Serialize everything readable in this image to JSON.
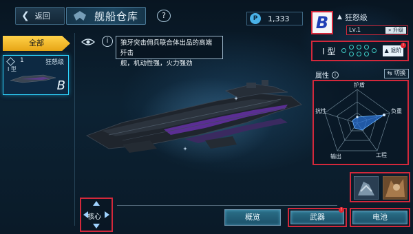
{
  "header": {
    "back_label": "返回",
    "title": "舰船仓库",
    "help_label": "?"
  },
  "sidebar": {
    "filter_label": "全部",
    "ship_card": {
      "number": "1",
      "name": "狂怒级",
      "type": "I 型",
      "grade": "B"
    }
  },
  "info": {
    "description_line1": "狼牙突击佣兵联合体出品的高端歼击",
    "description_line2": "舰，机动性强，火力强劲"
  },
  "resource": {
    "icon": "P",
    "value": "1,333"
  },
  "ship": {
    "grade": "B",
    "name": "狂怒级",
    "level": "Lv.1",
    "upgrade_label": "升级"
  },
  "refit": {
    "type_label": "I 型",
    "refit_label": "退阶"
  },
  "attributes": {
    "title": "属性",
    "switch_label": "切换",
    "axes": [
      "护盾",
      "负重",
      "工程",
      "输出",
      "抗性"
    ]
  },
  "bottom": {
    "core_label": "核心",
    "tabs": [
      "概览",
      "武器",
      "电池"
    ]
  },
  "colors": {
    "highlight_border": "#d3283b",
    "accent_cyan": "#2ed5ff",
    "filter_yellow": "#f2b825",
    "radar_fill": "#2a6fd0"
  },
  "icons": [
    "back-chevron-icon",
    "ship-emblem-icon",
    "help-icon",
    "eye-icon",
    "info-icon",
    "resource-p-icon",
    "switch-icon",
    "upgrade-icon",
    "refit-icon"
  ]
}
